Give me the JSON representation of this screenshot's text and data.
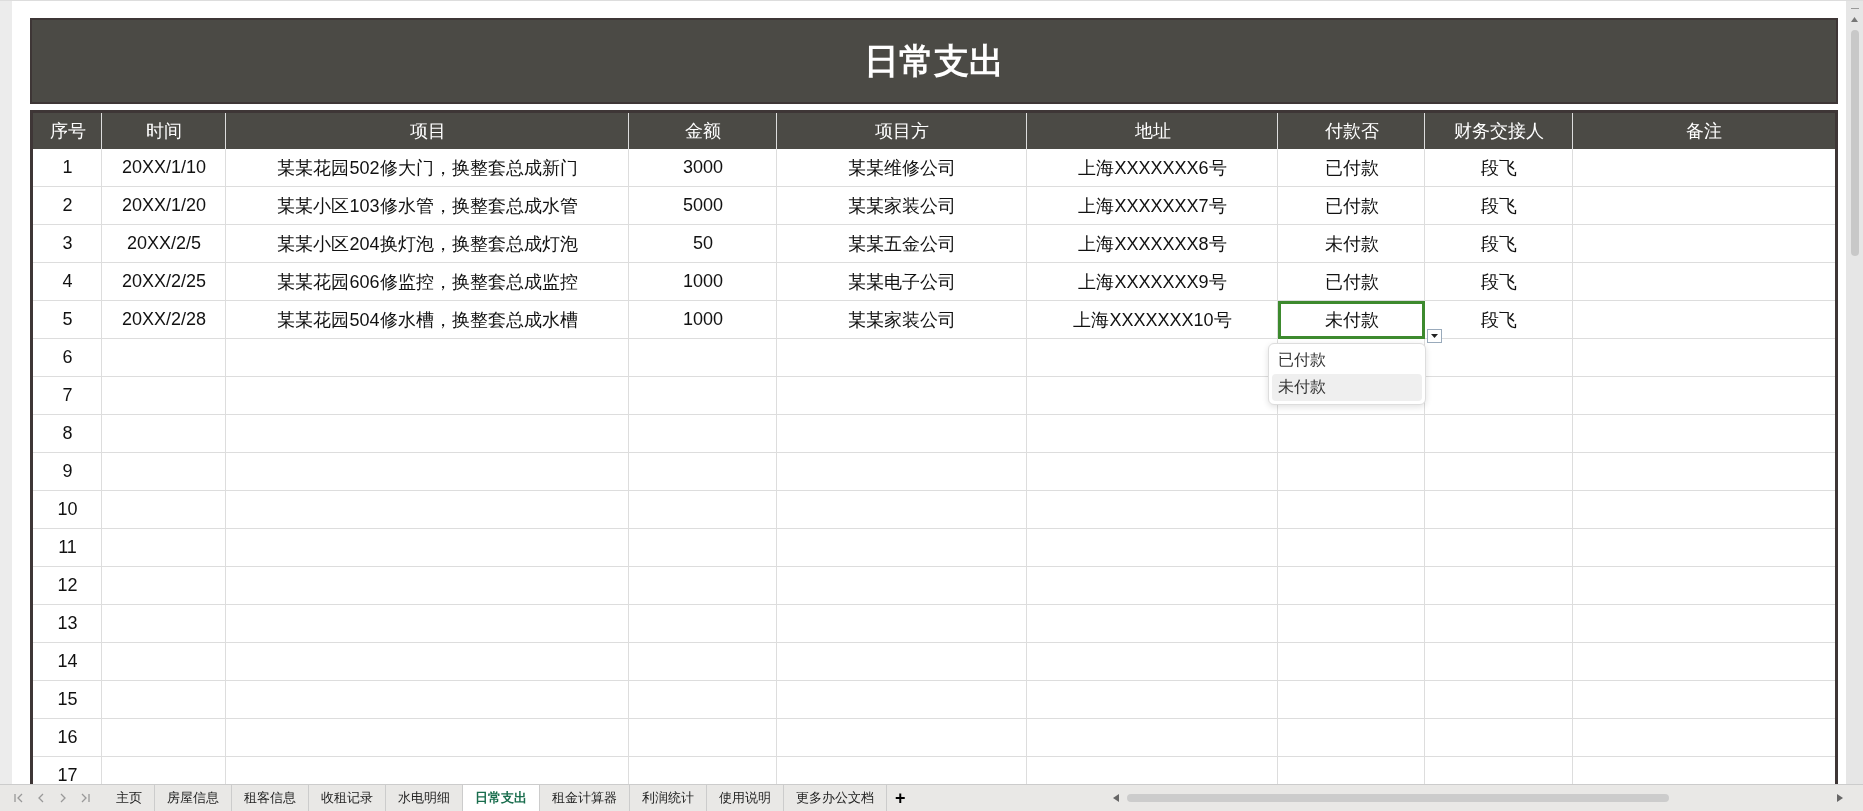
{
  "title": "日常支出",
  "columns": [
    "序号",
    "时间",
    "项目",
    "金额",
    "项目方",
    "地址",
    "付款否",
    "财务交接人",
    "备注"
  ],
  "rows": [
    {
      "cells": [
        "1",
        "20XX/1/10",
        "某某花园502修大门，换整套总成新门",
        "3000",
        "某某维修公司",
        "上海XXXXXXX6号",
        "已付款",
        "段飞"
      ],
      "status_cell_selected": false
    },
    {
      "cells": [
        "2",
        "20XX/1/20",
        "某某小区103修水管，换整套总成水管",
        "5000",
        "某某家装公司",
        "上海XXXXXXX7号",
        "已付款",
        "段飞"
      ],
      "status_cell_selected": false
    },
    {
      "cells": [
        "3",
        "20XX/2/5",
        "某某小区204换灯泡，换整套总成灯泡",
        "50",
        "某某五金公司",
        "上海XXXXXXX8号",
        "未付款",
        "段飞"
      ],
      "status_cell_selected": false
    },
    {
      "cells": [
        "4",
        "20XX/2/25",
        "某某花园606修监控，换整套总成监控",
        "1000",
        "某某电子公司",
        "上海XXXXXXX9号",
        "已付款",
        "段飞"
      ],
      "status_cell_selected": false
    },
    {
      "cells": [
        "5",
        "20XX/2/28",
        "某某花园504修水槽，换整套总成水槽",
        "1000",
        "某某家装公司",
        "上海XXXXXXX10号",
        "未付款",
        "段飞"
      ],
      "status_cell_selected": true
    },
    {
      "cells": [
        "6"
      ]
    },
    {
      "cells": [
        "7"
      ]
    },
    {
      "cells": [
        "8"
      ]
    },
    {
      "cells": [
        "9"
      ]
    },
    {
      "cells": [
        "10"
      ]
    },
    {
      "cells": [
        "11"
      ]
    },
    {
      "cells": [
        "12"
      ]
    },
    {
      "cells": [
        "13"
      ]
    },
    {
      "cells": [
        "14"
      ]
    },
    {
      "cells": [
        "15"
      ]
    },
    {
      "cells": [
        "16"
      ]
    },
    {
      "cells": [
        "17"
      ]
    }
  ],
  "dropdown": {
    "options": [
      {
        "label": "已付款",
        "selected": false
      },
      {
        "label": "未付款",
        "selected": true
      }
    ]
  },
  "sheet_tabs": [
    {
      "label": "主页",
      "selected": false
    },
    {
      "label": "房屋信息",
      "selected": false
    },
    {
      "label": "租客信息",
      "selected": false
    },
    {
      "label": "收租记录",
      "selected": false
    },
    {
      "label": "水电明细",
      "selected": false
    },
    {
      "label": "日常支出",
      "selected": true
    },
    {
      "label": "租金计算器",
      "selected": false
    },
    {
      "label": "利润统计",
      "selected": false
    },
    {
      "label": "使用说明",
      "selected": false
    },
    {
      "label": "更多办公文档",
      "selected": false
    }
  ],
  "add_sheet": "+"
}
